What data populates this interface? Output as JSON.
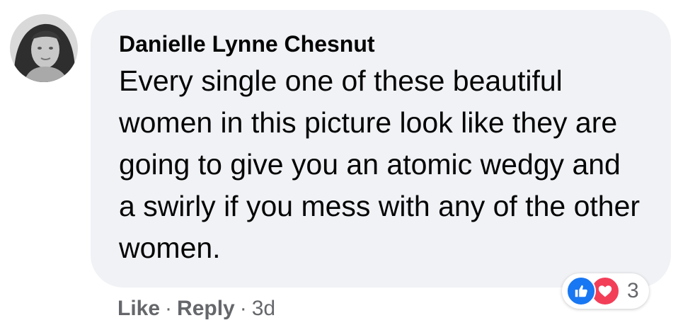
{
  "comment": {
    "author": "Danielle Lynne Chesnut",
    "text": "Every single one of these beautiful women in this picture look like they are going to give you an atomic wedgy and a swirly if you mess with any of the other women.",
    "avatar_icon": "profile-photo"
  },
  "actions": {
    "like_label": "Like",
    "separator": "·",
    "reply_label": "Reply",
    "timestamp": "3d"
  },
  "reactions": {
    "icons": [
      "like-icon",
      "love-icon"
    ],
    "count": "3"
  },
  "colors": {
    "bubble": "#f0f2f5",
    "text": "#050505",
    "secondary": "#65676b",
    "like_blue": "#1877f2",
    "love_red": "#f33e58"
  }
}
